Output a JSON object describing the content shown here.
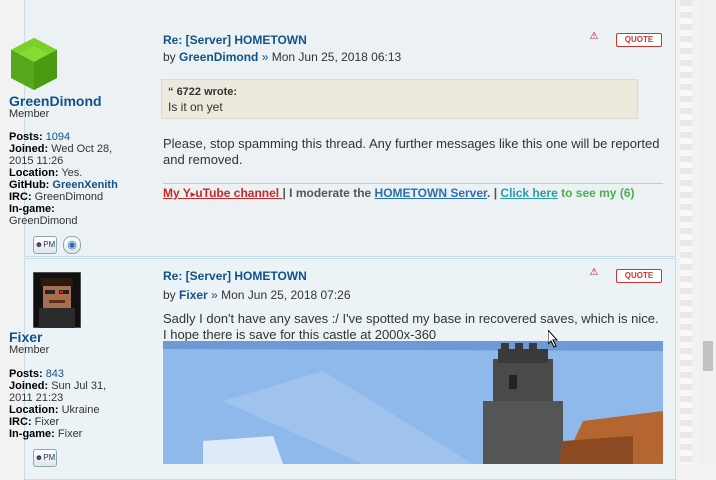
{
  "posts": [
    {
      "title": "Re: [Server] HOMETOWN",
      "by": "by",
      "author": "GreenDimond",
      "sep": "»",
      "date": "Mon Jun 25, 2018 06:13",
      "rank": "Member",
      "facts": {
        "posts_label": "Posts:",
        "posts": "1094",
        "joined_label": "Joined:",
        "joined": "Wed Oct 28, 2015 11:26",
        "joined_1": "Wed Oct 28,",
        "joined_2": "2015 11:26",
        "location_label": "Location:",
        "location": "Yes.",
        "github_label": "GitHub:",
        "github": "GreenXenith",
        "irc_label": "IRC:",
        "irc": "GreenDimond",
        "ingame_label": "In-game:",
        "ingame": "GreenDimond"
      },
      "quote": {
        "author": "6722 wrote:",
        "text": "Is it on yet"
      },
      "body_1": "Please, stop spamming this thread. Any further messages like this one will be reported",
      "body_2": "and removed.",
      "signature": {
        "part1": "My Y",
        "part1b": "uTube channel",
        "sep1": "|",
        "part2": "I moderate the",
        "link2": "HOMETOWN Server",
        "sep2": ". |",
        "link3": "Click here",
        "part3": "to see my (6)"
      },
      "quote_label": "QUOTE",
      "pm_label": "PM"
    },
    {
      "title": "Re: [Server] HOMETOWN",
      "by": "by",
      "author": "Fixer",
      "sep": "»",
      "date": "Mon Jun 25, 2018 07:26",
      "rank": "Member",
      "facts": {
        "posts_label": "Posts:",
        "posts": "843",
        "joined_label": "Joined:",
        "joined_1": "Sun Jul 31,",
        "joined_2": "2011 21:23",
        "location_label": "Location:",
        "location": "Ukraine",
        "irc_label": "IRC:",
        "irc": "Fixer",
        "ingame_label": "In-game:",
        "ingame": "Fixer"
      },
      "body_1": "Sadly I don't have any saves :/ I've spotted my base in recovered saves, which is nice.",
      "body_2": "I hope there is save for this castle at 2000x-360",
      "quote_label": "QUOTE",
      "pm_label": "PM"
    }
  ],
  "colors": {
    "link": "#105289",
    "sig_red": "#c62828",
    "sig_green": "#4caf50",
    "quote_bg": "#ebeadd"
  }
}
